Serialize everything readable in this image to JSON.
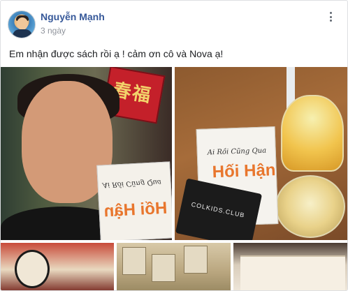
{
  "post": {
    "author": "Nguyễn Mạnh",
    "time": "3 ngày",
    "text": "Em nhận được sách rồi ạ ! cảm ơn cô và Nova ạ!"
  },
  "photos": {
    "photo1": {
      "book_title": "Ai Rồi Cũng Qua",
      "book_big": "Hối Hận"
    },
    "photo2": {
      "book_title": "Ai Rồi Cũng Qua",
      "book_big": "Hối Hận",
      "pouch_text": "COLKIDS.CLUB"
    }
  },
  "icons": {
    "more": "more-options-icon",
    "privacy": "globe-icon"
  },
  "colors": {
    "author_link": "#365899",
    "meta_text": "#90949c",
    "body_text": "#1c1e21"
  }
}
